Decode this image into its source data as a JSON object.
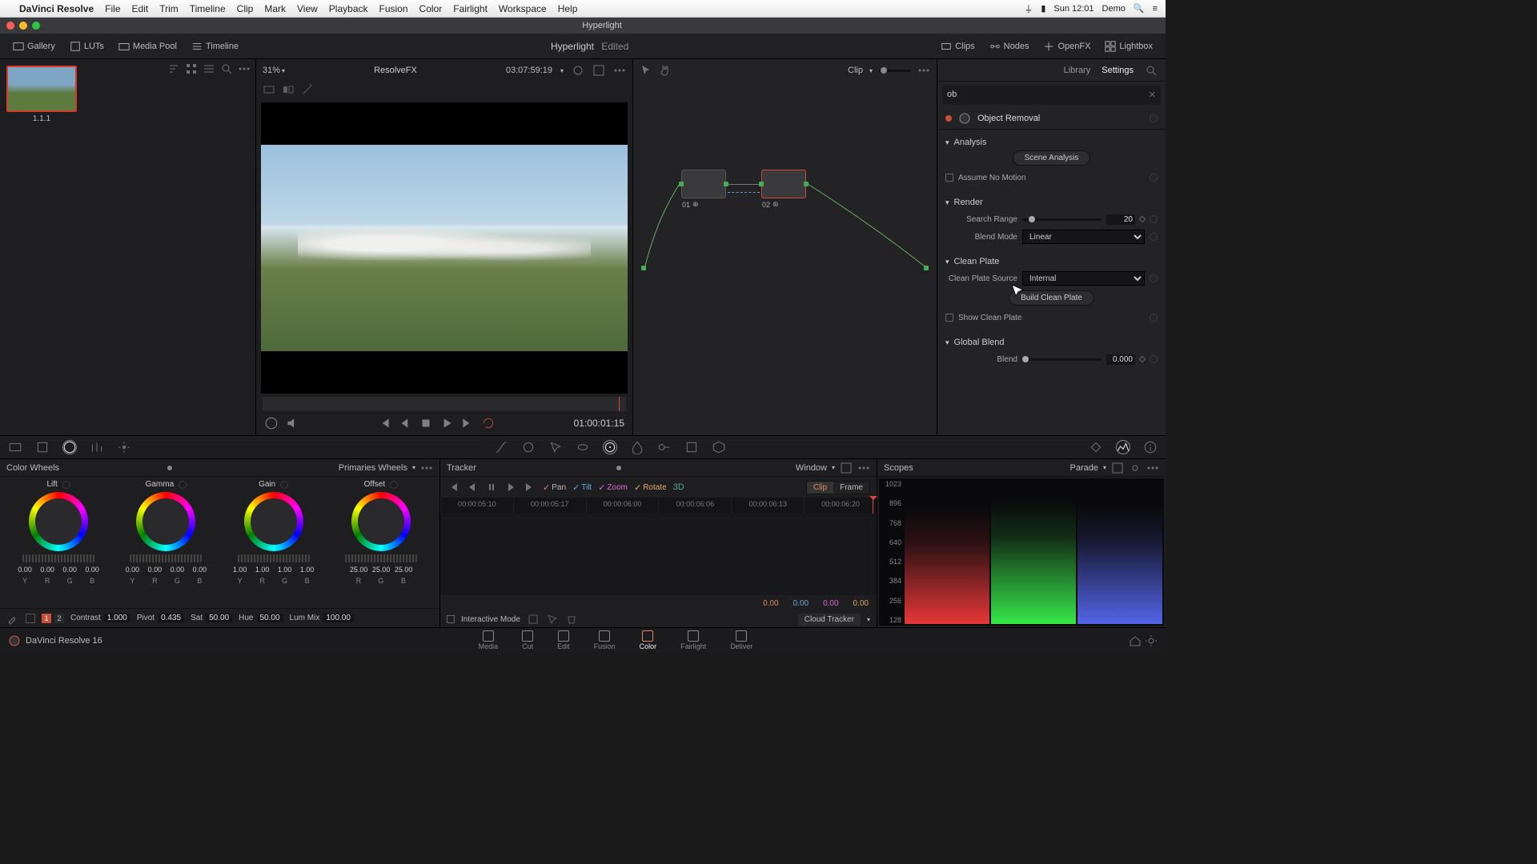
{
  "mac": {
    "app": "DaVinci Resolve",
    "menus": [
      "File",
      "Edit",
      "Trim",
      "Timeline",
      "Clip",
      "Mark",
      "View",
      "Playback",
      "Fusion",
      "Color",
      "Fairlight",
      "Workspace",
      "Help"
    ],
    "clock": "Sun 12:01",
    "user": "Demo"
  },
  "titlebar": {
    "title": "Hyperlight"
  },
  "topbar": {
    "gallery": "Gallery",
    "luts": "LUTs",
    "mediapool": "Media Pool",
    "timeline": "Timeline",
    "project": "Hyperlight",
    "edited": "Edited",
    "clips": "Clips",
    "nodes": "Nodes",
    "openfx": "OpenFX",
    "lightbox": "Lightbox"
  },
  "gallery": {
    "thumb_caption": "1.1.1"
  },
  "viewer": {
    "zoom": "31%",
    "effect": "ResolveFX",
    "srcTC": "03:07:59:19",
    "recTC": "01:00:01:15"
  },
  "nodes": {
    "clip": "Clip",
    "n1": "01",
    "n2": "02"
  },
  "inspector": {
    "tab_library": "Library",
    "tab_settings": "Settings",
    "search": "ob",
    "fx_name": "Object Removal",
    "sec_analysis": "Analysis",
    "btn_scene": "Scene Analysis",
    "chk_nomotion": "Assume No Motion",
    "sec_render": "Render",
    "lbl_range": "Search Range",
    "val_range": "20",
    "lbl_blend": "Blend Mode",
    "opt_blend": "Linear",
    "sec_clean": "Clean Plate",
    "lbl_src": "Clean Plate Source",
    "opt_src": "Internal",
    "btn_build": "Build Clean Plate",
    "chk_show": "Show Clean Plate",
    "sec_global": "Global Blend",
    "lbl_gblend": "Blend",
    "val_gblend": "0.000"
  },
  "wheels": {
    "title": "Color Wheels",
    "mode": "Primaries Wheels",
    "names": [
      "Lift",
      "Gamma",
      "Gain",
      "Offset"
    ],
    "lift": {
      "y": "0.00",
      "r": "0.00",
      "g": "0.00",
      "b": "0.00"
    },
    "gamma": {
      "y": "0.00",
      "r": "0.00",
      "g": "0.00",
      "b": "0.00"
    },
    "gain": {
      "y": "1.00",
      "r": "1.00",
      "g": "1.00",
      "b": "1.00"
    },
    "offset": {
      "r": "25.00",
      "g": "25.00",
      "b": "25.00"
    },
    "ch4": [
      "Y",
      "R",
      "G",
      "B"
    ],
    "ch3": [
      "R",
      "G",
      "B"
    ],
    "adj": {
      "contrast_l": "Contrast",
      "contrast": "1.000",
      "pivot_l": "Pivot",
      "pivot": "0.435",
      "sat_l": "Sat",
      "sat": "50.00",
      "hue_l": "Hue",
      "hue": "50.00",
      "lum_l": "Lum Mix",
      "lum": "100.00"
    },
    "pages": [
      "1",
      "2"
    ]
  },
  "tracker": {
    "title": "Tracker",
    "mode": "Window",
    "pan": "Pan",
    "tilt": "Tilt",
    "zoom": "Zoom",
    "rotate": "Rotate",
    "threeD": "3D",
    "clip": "Clip",
    "frame": "Frame",
    "ruler": [
      "00:00:05:10",
      "00:00:05:17",
      "00:00:06:00",
      "00:00:06:06",
      "00:00:06:13",
      "00:00:06:20"
    ],
    "vals": [
      "0.00",
      "0.00",
      "0.00",
      "0.00"
    ],
    "interactive": "Interactive Mode",
    "cloud": "Cloud Tracker"
  },
  "scopes": {
    "title": "Scopes",
    "mode": "Parade",
    "axis": [
      "1023",
      "896",
      "768",
      "640",
      "512",
      "384",
      "256",
      "128"
    ]
  },
  "pagebar": {
    "brand": "DaVinci Resolve 16",
    "pages": [
      "Media",
      "Cut",
      "Edit",
      "Fusion",
      "Color",
      "Fairlight",
      "Deliver"
    ],
    "active": "Color"
  }
}
